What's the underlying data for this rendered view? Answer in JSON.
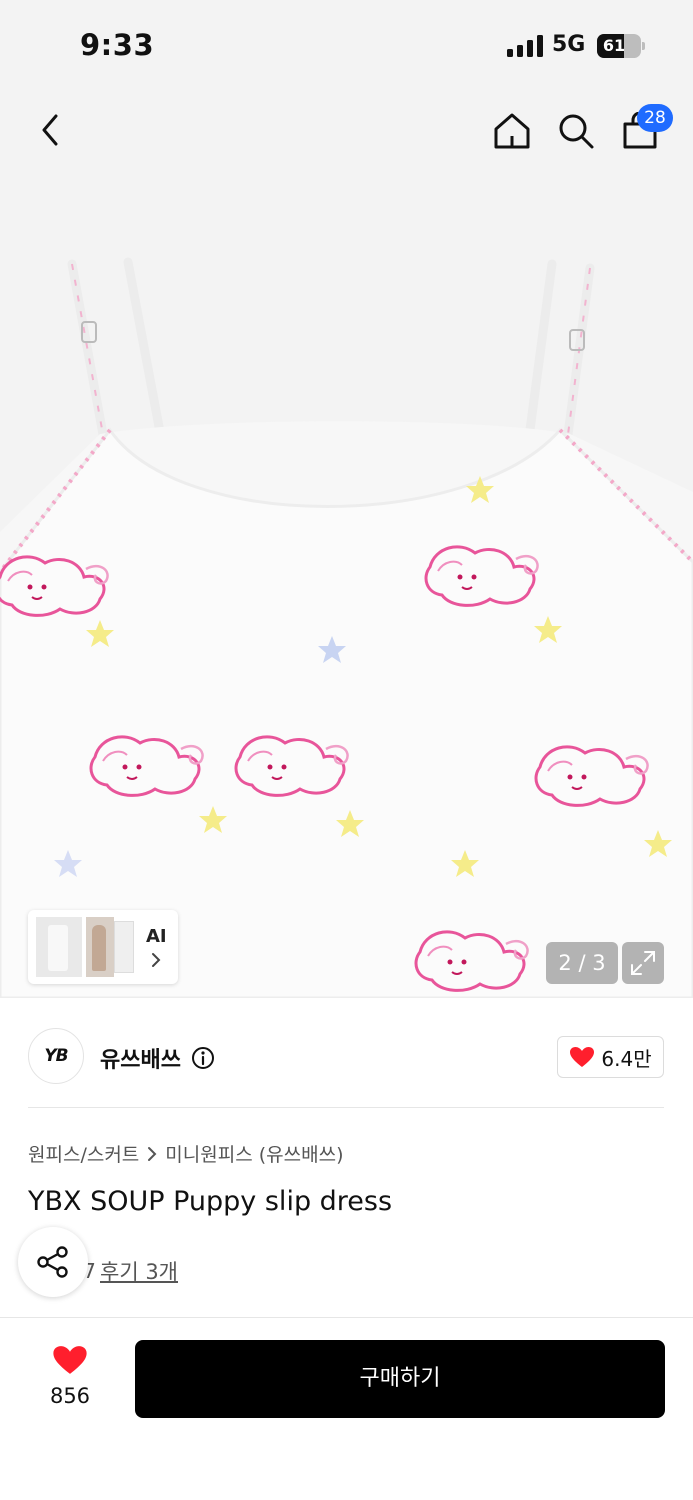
{
  "status_bar": {
    "time": "9:33",
    "network": "5G",
    "battery": "61",
    "battery_level": 0.61
  },
  "nav": {
    "cart_count": "28",
    "icons": [
      "chevron-left-icon",
      "home-icon",
      "search-icon",
      "shopping-bag-icon"
    ]
  },
  "gallery": {
    "thumbnail_label": "AI",
    "page_counter": "2 / 3"
  },
  "brand": {
    "name": "유쓰배쓰",
    "logo_text": "YB",
    "likes": "6.4만"
  },
  "product": {
    "breadcrumb": [
      "원피스/스커트",
      "미니원피스 (유쓰배쓰)"
    ],
    "title": "YBX SOUP Puppy slip dress",
    "rating": "4.7",
    "reviews": "후기 3개"
  },
  "bottom_bar": {
    "wish_count": "856",
    "buy_label": "구매하기"
  },
  "colors": {
    "accent_blue": "#1f6bff",
    "heart_red": "#ff1f2d",
    "buy_button": "#000000"
  }
}
